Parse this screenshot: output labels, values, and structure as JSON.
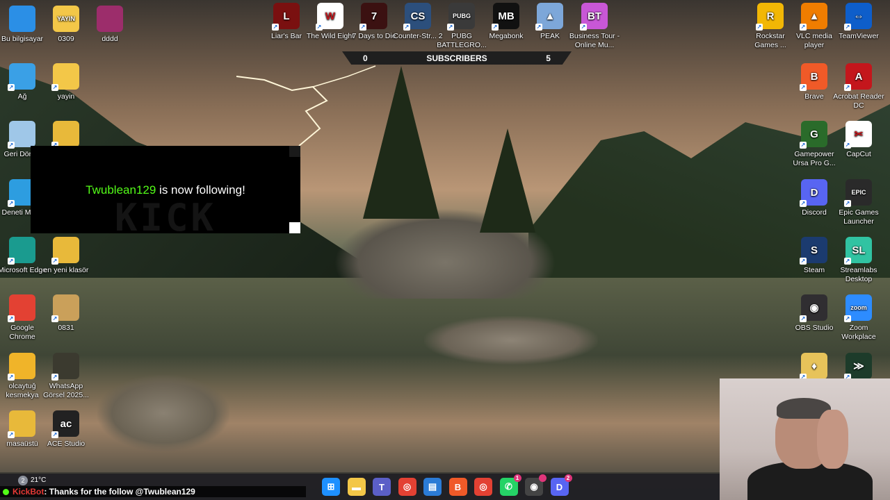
{
  "desktop_icons_left": [
    {
      "label": "Bu bilgisayar",
      "icon": "computer-icon",
      "color": "#2b8fe6"
    },
    {
      "label": "0309",
      "icon": "folder-icon",
      "color": "#f3c748",
      "tag": "YAYIN"
    },
    {
      "label": "dddd",
      "icon": "winrar-icon",
      "color": "#9c2d6b"
    },
    {
      "label": "Ağ",
      "icon": "network-icon",
      "color": "#3aa0e6"
    },
    {
      "label": "yayin",
      "icon": "folder-icon",
      "color": "#f3c748"
    },
    {
      "label": "Geri Dönüş",
      "icon": "recycle-bin-icon",
      "color": "#9fc7e8"
    },
    {
      "label": "",
      "icon": "folder-icon",
      "color": "#e8b93a"
    },
    {
      "label": "Deneti Masa",
      "icon": "control-panel-icon",
      "color": "#2d9de0"
    },
    {
      "label": "Microsoft Edge",
      "icon": "edge-icon",
      "color": "#1a9b8f"
    },
    {
      "label": "en yeni klasör",
      "icon": "folder-icon",
      "color": "#e8b93a"
    },
    {
      "label": "Google Chrome",
      "icon": "chrome-icon",
      "color": "#e34133"
    },
    {
      "label": "0831",
      "icon": "folder-icon",
      "color": "#caa05a"
    },
    {
      "label": "olcaytuğ kesmekya",
      "icon": "user-folder-icon",
      "color": "#f0b429"
    },
    {
      "label": "WhatsApp Görsel 2025...",
      "icon": "image-icon",
      "color": "#3b3a2f"
    },
    {
      "label": "masaüstü",
      "icon": "folder-icon",
      "color": "#e8b93a"
    },
    {
      "label": "ACE Studio",
      "icon": "ace-studio-icon",
      "color": "#222222",
      "tag": "ac"
    }
  ],
  "desktop_icons_top": [
    {
      "label": "Liar's Bar",
      "icon": "liars-bar-icon",
      "color": "#7a1010",
      "tag": "L"
    },
    {
      "label": "The Wild Eight",
      "icon": "wild-eight-icon",
      "color": "#ffffff",
      "tag": "W"
    },
    {
      "label": "7 Days to Die",
      "icon": "seven-days-icon",
      "color": "#3b1111",
      "tag": "7"
    },
    {
      "label": "Counter-Str... 2",
      "icon": "counter-strike-icon",
      "color": "#2c4f7c",
      "tag": "CS"
    },
    {
      "label": "PUBG BATTLEGRO...",
      "icon": "pubg-icon",
      "color": "#3a3a3a",
      "tag": "PUBG"
    },
    {
      "label": "Megabonk",
      "icon": "megabonk-icon",
      "color": "#111111",
      "tag": "MB"
    },
    {
      "label": "PEAK",
      "icon": "peak-icon",
      "color": "#7da7d9",
      "tag": "▲"
    },
    {
      "label": "Business Tour - Online Mu...",
      "icon": "business-tour-icon",
      "color": "#c857d6",
      "tag": "BT"
    }
  ],
  "desktop_icons_right": [
    {
      "label": "Rockstar Games ...",
      "icon": "rockstar-icon",
      "color": "#f2b705",
      "tag": "R"
    },
    {
      "label": "VLC media player",
      "icon": "vlc-icon",
      "color": "#f07d00",
      "tag": "▲"
    },
    {
      "label": "TeamViewer",
      "icon": "teamviewer-icon",
      "color": "#0e5eca",
      "tag": "⇔"
    },
    {
      "label": "Brave",
      "icon": "brave-icon",
      "color": "#f05a28",
      "tag": "B"
    },
    {
      "label": "Acrobat Reader DC",
      "icon": "acrobat-icon",
      "color": "#c4161c",
      "tag": "A"
    },
    {
      "label": "Gamepower Ursa Pro G...",
      "icon": "gamepower-icon",
      "color": "#2a6b2a",
      "tag": "G"
    },
    {
      "label": "CapCut",
      "icon": "capcut-icon",
      "color": "#ffffff",
      "tag": "✂"
    },
    {
      "label": "Discord",
      "icon": "discord-icon",
      "color": "#5865f2",
      "tag": "D"
    },
    {
      "label": "Epic Games Launcher",
      "icon": "epic-games-icon",
      "color": "#2a2a2a",
      "tag": "EPIC"
    },
    {
      "label": "Steam",
      "icon": "steam-icon",
      "color": "#1b3b6f",
      "tag": "S"
    },
    {
      "label": "Streamlabs Desktop",
      "icon": "streamlabs-icon",
      "color": "#31c3a2",
      "tag": "SL"
    },
    {
      "label": "OBS Studio",
      "icon": "obs-icon",
      "color": "#302e31",
      "tag": "◉"
    },
    {
      "label": "Zoom Workplace",
      "icon": "zoom-icon",
      "color": "#2d8cff",
      "tag": "zoom"
    },
    {
      "label": "",
      "icon": "app-icon",
      "color": "#e7c35a",
      "tag": "♦"
    },
    {
      "label": "",
      "icon": "app-icon",
      "color": "#1d3b2a",
      "tag": "≫"
    }
  ],
  "subscribers_bar": {
    "left_value": "0",
    "label": "SUBSCRIBERS",
    "right_value": "5"
  },
  "follow_alert": {
    "username": "Twublean129",
    "message": " is now following!",
    "watermark": "KICK",
    "accent": "#53fc18"
  },
  "taskbar": {
    "weather": {
      "temperature": "21°C",
      "badge": "2"
    },
    "items": [
      {
        "icon": "windows-start-icon",
        "color": "#1e90ff",
        "tag": "⊞"
      },
      {
        "icon": "file-explorer-icon",
        "color": "#f3c748",
        "tag": "▬"
      },
      {
        "icon": "teams-icon",
        "color": "#5b5fc7",
        "tag": "T"
      },
      {
        "icon": "chrome-icon",
        "color": "#e34133",
        "tag": "◎"
      },
      {
        "icon": "store-icon",
        "color": "#2b7bd6",
        "tag": "▤"
      },
      {
        "icon": "brave-icon",
        "color": "#f05a28",
        "tag": "B"
      },
      {
        "icon": "chrome-icon",
        "color": "#e34133",
        "tag": "◎"
      },
      {
        "icon": "whatsapp-icon",
        "color": "#25d366",
        "tag": "✆",
        "badge": "1"
      },
      {
        "icon": "obs-icon",
        "color": "#444444",
        "tag": "◉",
        "badge": ""
      },
      {
        "icon": "discord-icon",
        "color": "#5865f2",
        "tag": "D",
        "badge": "2"
      }
    ]
  },
  "chat": {
    "bot_name": "KickBot",
    "message": ": Thanks for the follow @Twublean129"
  }
}
